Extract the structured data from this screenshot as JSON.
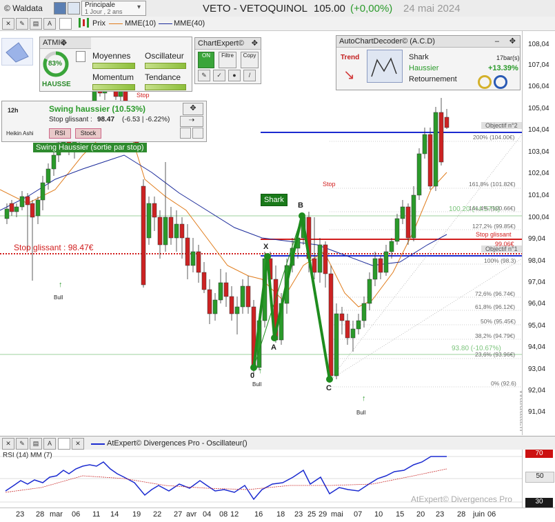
{
  "header": {
    "app": "© Waldata",
    "layout_name": "Principale",
    "layout_period": "1 Jour , 2 ans",
    "ticker": "VETO - VETOQUINOL",
    "price": "105.00",
    "change": "(+0,00%)",
    "date": "24 mai 2024"
  },
  "toolbar": {
    "prix": "Prix",
    "mme10": "MME(10)",
    "mme40": "MME(40)"
  },
  "atmi": {
    "title": "ATMI©",
    "score": "83%",
    "state": "HAUSSE",
    "labels": [
      "Moyennes",
      "Oscillateur",
      "Momentum",
      "Tendance"
    ]
  },
  "chartexpert": {
    "title": "ChartExpert©",
    "btn_on": "ON",
    "btn_filtre": "Filtre",
    "btn_copy": "Copy"
  },
  "acd": {
    "title": "AutoChartDecoder© (A.C.D)",
    "trend_label": "Trend",
    "pattern": "Shark",
    "direction": "Haussier",
    "reversal": "Retournement",
    "bars": "17bar(s)",
    "perf": "+13.39%"
  },
  "swing": {
    "title": "Swing haussier (10.53%)",
    "stop_label": "Stop glissant :",
    "stop_value": "98.47",
    "stop_detail": "(-6.53 | -6.22%)",
    "rsi_btn": "RSI",
    "stock_btn": "Stock",
    "period": "12h",
    "candle_type": "Heikin Ashi",
    "banner": "Swing Haussier (sortie par stop)"
  },
  "chart_labels": {
    "stop_glissant": "Stop glissant : 98.47€",
    "stop_small": "Stop",
    "shark": "Shark",
    "objectif2": "Objectif n°2",
    "objectif1": "Objectif n°1",
    "stop_glissant_right": "Stop glissant",
    "stop_glissant_right_val": "99.06€",
    "bull": "Bull",
    "pt_x": "X",
    "pt_a": "A",
    "pt_b": "B",
    "pt_c": "C",
    "pt_0": "0",
    "green_level_top": "100.20 (+4.57%)",
    "green_level_bottom": "93.80 (-10.67%)",
    "watermark": "Waldata.fr"
  },
  "fib_levels": [
    {
      "label": "200% (104.00€)"
    },
    {
      "label": "161,8% (101.82€)"
    },
    {
      "label": "141,4% (100.66€)"
    },
    {
      "label": "127,2% (99.85€)"
    },
    {
      "label": "100% (98.3)"
    },
    {
      "label": "72,6% (96.74€)"
    },
    {
      "label": "61,8% (96.12€)"
    },
    {
      "label": "50% (95.45€)"
    },
    {
      "label": "38,2% (94.79€)"
    },
    {
      "label": "23,6% (93.96€)"
    },
    {
      "label": "0% (92.6)"
    }
  ],
  "y_axis": [
    "108,04",
    "107,04",
    "106,04",
    "105,04",
    "104,04",
    "103,04",
    "102,04",
    "101,04",
    "100,04",
    "99,04",
    "98,04",
    "97,04",
    "96,04",
    "95,04",
    "94,04",
    "93,04",
    "92,04",
    "91,04"
  ],
  "x_axis": [
    "23",
    "28",
    "mar",
    "06",
    "11",
    "14",
    "19",
    "22",
    "27",
    "avr",
    "04",
    "08",
    "12",
    "16",
    "18",
    "23",
    "25",
    "29",
    "mai",
    "07",
    "10",
    "15",
    "20",
    "23",
    "28",
    "juin",
    "06"
  ],
  "oscillator": {
    "title": "AtExpert© Divergences Pro - Oscillateur()",
    "rsi_label": "RSI (14) MM (7)",
    "levels": [
      "70",
      "50",
      "30"
    ],
    "footer": "AtExpert© Divergences Pro"
  },
  "colors": {
    "candle_up": "#2a9a2a",
    "candle_down": "#cc2222",
    "mme10": "#e07b1a",
    "mme40": "#1a2a9a",
    "pattern": "#1e8c1e",
    "stop": "#d11c1c"
  }
}
